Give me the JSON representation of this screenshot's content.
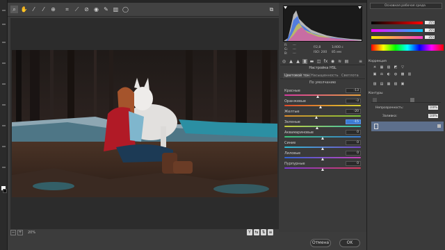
{
  "window": {
    "workspace": "Основная рабочая среда"
  },
  "toolbar": {
    "tools": [
      "zoom-icon",
      "hand-icon",
      "white-balance-icon",
      "color-sampler-icon",
      "target-adjust-icon",
      "crop-icon",
      "straighten-icon",
      "spot-removal-icon",
      "redeye-icon",
      "adjustment-brush-icon",
      "graduated-filter-icon",
      "radial-filter-icon"
    ],
    "preview_icon": "toggle-fullscreen-icon"
  },
  "info": {
    "r_label": "R:",
    "g_label": "G:",
    "b_label": "B:",
    "r_value": "---",
    "g_value": "---",
    "b_value": "---",
    "aperture": "f/2,8",
    "shutter": "1/400 с",
    "iso": "ISO: 200",
    "focal": "85 мм"
  },
  "panel": {
    "title": "Настройка HSL",
    "tabs": [
      "Цветовой тон",
      "Насыщенность",
      "Светлота"
    ],
    "active_tab": 0,
    "default_label": "По умолчанию",
    "sliders": [
      {
        "label": "Красные",
        "value": "-13",
        "pos": 0.44,
        "from": "#d63aa0",
        "to": "#e8a23a"
      },
      {
        "label": "Оранжевые",
        "value": "-3",
        "pos": 0.48,
        "from": "#e24a2c",
        "to": "#d9d42e"
      },
      {
        "label": "Желтые",
        "value": "-20",
        "pos": 0.42,
        "from": "#e08d2a",
        "to": "#7bcb3a"
      },
      {
        "label": "Зеленые",
        "value": "-15",
        "pos": 0.43,
        "from": "#c9cf3a",
        "to": "#2fc2b6"
      },
      {
        "label": "Аквамариновые",
        "value": "0",
        "pos": 0.5,
        "from": "#3cc67a",
        "to": "#3a7bd8"
      },
      {
        "label": "Синие",
        "value": "0",
        "pos": 0.5,
        "from": "#2fbfd6",
        "to": "#7a46c9"
      },
      {
        "label": "Лиловые",
        "value": "0",
        "pos": 0.5,
        "from": "#2f64d6",
        "to": "#cc3fb9"
      },
      {
        "label": "Пурпурные",
        "value": "0",
        "pos": 0.5,
        "from": "#7b3ad6",
        "to": "#d83a5c"
      }
    ],
    "highlighted_index": 3
  },
  "bottom": {
    "zoom": "20%",
    "cancel_label": "Отмена",
    "ok_label": "OK"
  },
  "ps_panel": {
    "color_values": [
      "255",
      "255",
      "255"
    ],
    "adjust_label": "Коррекция",
    "layers_label": "Контуры",
    "opacity_label": "Непрозрачность:",
    "opacity_value": "100%",
    "fill_label": "Заливка:",
    "fill_value": "100%"
  }
}
